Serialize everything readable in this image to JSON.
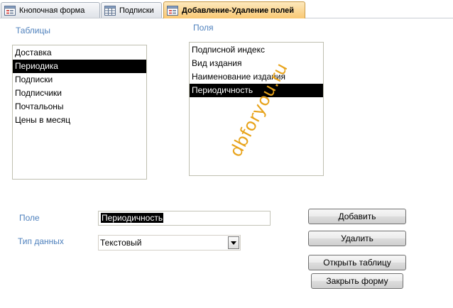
{
  "tabs": [
    {
      "label": "Кнопочная форма",
      "icon": "form-icon",
      "active": false
    },
    {
      "label": "Подписки",
      "icon": "table-icon",
      "active": false
    },
    {
      "label": "Добавление-Удаление полей",
      "icon": "form-icon",
      "active": true
    }
  ],
  "tables_panel": {
    "label": "Таблицы",
    "items": [
      "Доставка",
      "Периодика",
      "Подписки",
      "Подписчики",
      "Почтальоны",
      "Цены в месяц"
    ],
    "selected": "Периодика"
  },
  "fields_panel": {
    "label": "Поля",
    "items": [
      "Подписной индекс",
      "Вид издания",
      "Наименование издания",
      "Периодичность"
    ],
    "selected": "Периодичность"
  },
  "form": {
    "field_label": "Поле",
    "field_value": "Периодичность",
    "datatype_label": "Тип данных",
    "datatype_value": "Текстовый"
  },
  "buttons": {
    "add": "Добавить",
    "delete": "Удалить",
    "open_table": "Открыть таблицу",
    "close_form": "Закрыть форму"
  },
  "watermark": "dbforyou.ru",
  "colors": {
    "label_blue": "#4f81bd",
    "active_tab": "#f9c873",
    "watermark": "#e8a31a",
    "selection": "#000000"
  }
}
